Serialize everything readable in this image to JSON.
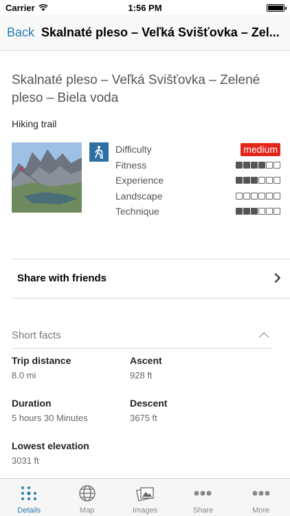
{
  "status_bar": {
    "carrier": "Carrier",
    "time": "1:56 PM"
  },
  "nav": {
    "back_label": "Back",
    "title": "Skalnaté pleso – Veľká Svišťovka – Zel..."
  },
  "trail": {
    "title": "Skalnaté pleso – Veľká Svišťovka – Zelené pleso – Biela voda",
    "type": "Hiking trail",
    "ratings": [
      {
        "label": "Difficulty",
        "badge": "medium"
      },
      {
        "label": "Fitness",
        "level": 4,
        "max": 6
      },
      {
        "label": "Experience",
        "level": 3,
        "max": 6
      },
      {
        "label": "Landscape",
        "level": 0,
        "max": 6
      },
      {
        "label": "Technique",
        "level": 3,
        "max": 6
      }
    ]
  },
  "share": {
    "label": "Share with friends"
  },
  "short_facts": {
    "heading": "Short facts",
    "items": [
      {
        "label": "Trip distance",
        "value": "8.0 mi"
      },
      {
        "label": "Ascent",
        "value": "928 ft"
      },
      {
        "label": "Duration",
        "value": "5 hours 30 Minutes"
      },
      {
        "label": "Descent",
        "value": "3675 ft"
      },
      {
        "label": "Lowest elevation",
        "value": "3031 ft"
      }
    ]
  },
  "tabs": [
    {
      "label": "Details",
      "icon": "details-grid-icon",
      "active": true
    },
    {
      "label": "Map",
      "icon": "globe-icon"
    },
    {
      "label": "Images",
      "icon": "images-icon"
    },
    {
      "label": "Share",
      "icon": "share-dots-icon"
    },
    {
      "label": "More",
      "icon": "more-dots-icon"
    }
  ],
  "colors": {
    "accent": "#2a7ab0",
    "badge": "#e3261c",
    "hike_badge": "#2d6fa3"
  }
}
